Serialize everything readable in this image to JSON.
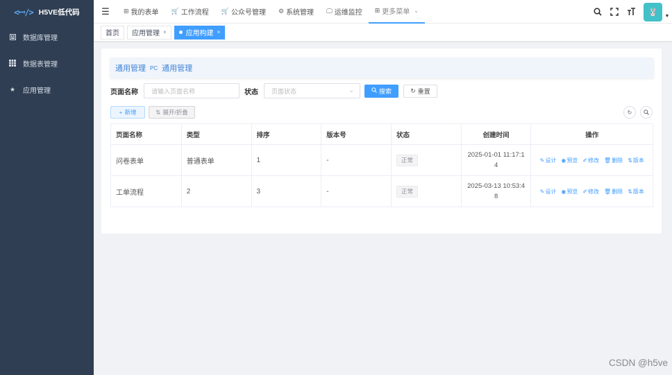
{
  "app": {
    "logo_mark": "<ꟷ/>",
    "title": "H5VE低代码"
  },
  "sidebar": {
    "items": [
      {
        "label": "数据库管理",
        "icon": "database-icon"
      },
      {
        "label": "数据表管理",
        "icon": "table-icon"
      },
      {
        "label": "应用管理",
        "icon": "star-icon"
      }
    ]
  },
  "topnav": {
    "items": [
      {
        "label": "我的表单",
        "icon": "form-icon"
      },
      {
        "label": "工作流程",
        "icon": "cart-icon"
      },
      {
        "label": "公众号管理",
        "icon": "cart-icon"
      },
      {
        "label": "系统管理",
        "icon": "gear-icon"
      },
      {
        "label": "运维监控",
        "icon": "monitor-icon"
      },
      {
        "label": "更多菜单",
        "icon": "grid-icon"
      }
    ]
  },
  "avatar": {
    "glyph": "🐰"
  },
  "tags": [
    {
      "label": "首页",
      "closable": false,
      "active": false
    },
    {
      "label": "应用管理",
      "closable": true,
      "active": false
    },
    {
      "label": "应用构建",
      "closable": true,
      "active": true
    }
  ],
  "breadcrumb": {
    "left": "通用管理",
    "tag": "PC",
    "right": "通用管理"
  },
  "search": {
    "name_label": "页面名称",
    "name_placeholder": "请输入页面名称",
    "status_label": "状态",
    "status_placeholder": "页面状态",
    "search_btn": "搜索",
    "reset_btn": "重置"
  },
  "toolbar": {
    "add_btn": "新增",
    "toggle_btn": "展开/折叠"
  },
  "table": {
    "headers": [
      "页面名称",
      "类型",
      "排序",
      "版本号",
      "状态",
      "创建时间",
      "操作"
    ],
    "rows": [
      {
        "name": "问卷表单",
        "type": "普通表单",
        "order": "1",
        "version": "-",
        "status": "正常",
        "created": "2025-01-01 11:17:14"
      },
      {
        "name": "工单流程",
        "type": "2",
        "order": "3",
        "version": "-",
        "status": "正常",
        "created": "2025-03-13 10:53:48"
      }
    ],
    "actions": [
      "设计",
      "预览",
      "修改",
      "删除",
      "版本"
    ]
  },
  "watermark": "CSDN @h5ve",
  "colors": {
    "sidebar_bg": "#2f3e52",
    "primary": "#409eff",
    "avatar_bg": "#43c1c9"
  }
}
